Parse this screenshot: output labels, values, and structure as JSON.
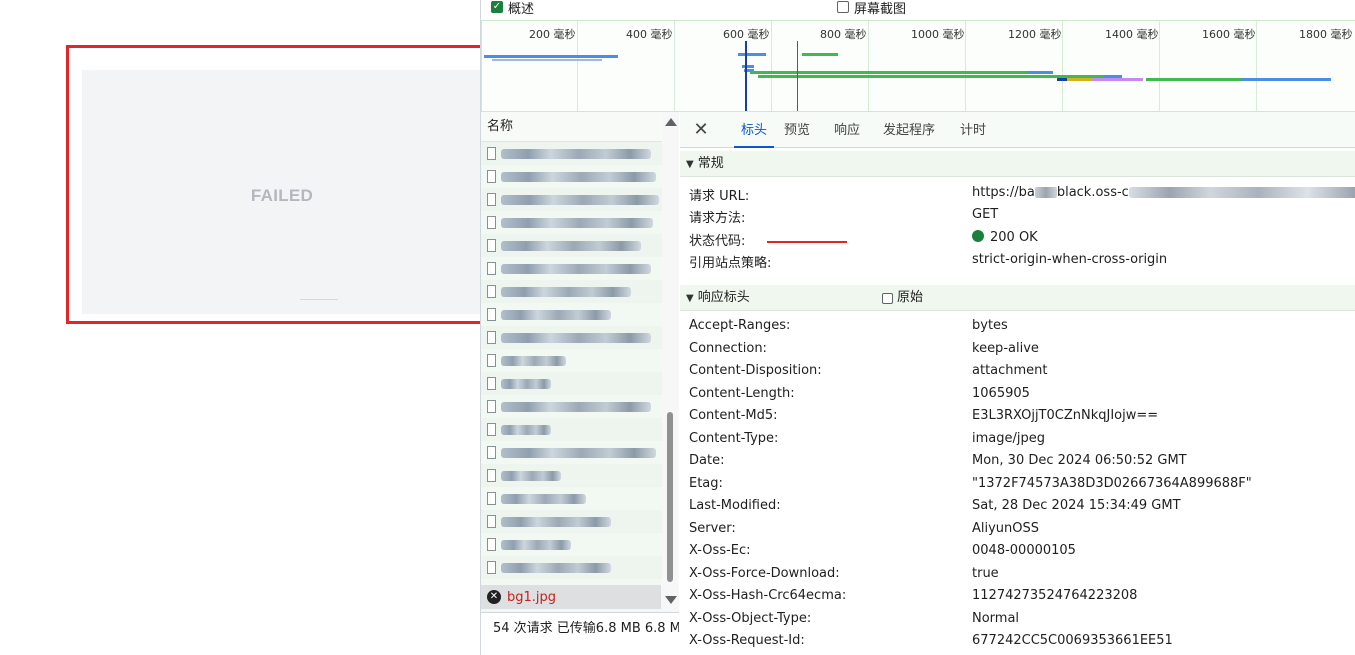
{
  "left_page": {
    "failed_text": "FAILED"
  },
  "options": {
    "overview_label": "概述",
    "overview_checked": true,
    "screenshot_label": "屏幕截图",
    "screenshot_checked": false
  },
  "timeline": {
    "tick_labels": [
      "200 毫秒",
      "400 毫秒",
      "600 毫秒",
      "800 毫秒",
      "1000 毫秒",
      "1200 毫秒",
      "1400 毫秒",
      "1600 毫秒",
      "1800 毫秒"
    ],
    "colors": {
      "green": "#3fb950",
      "blue": "#4a8ee8",
      "purple": "#c58af0",
      "yellow": "#d4b21a",
      "navy": "#1a3fa0",
      "red": "#d22"
    }
  },
  "request_list": {
    "header": "名称",
    "failed_item": {
      "name": "bg1.jpg"
    },
    "status": "54 次请求  已传输6.8 MB  6.8 M"
  },
  "details": {
    "tabs": [
      "标头",
      "预览",
      "响应",
      "发起程序",
      "计时"
    ],
    "active_tab": "标头",
    "general": {
      "title": "常规",
      "rows": [
        {
          "key": "请求 URL:",
          "value_prefix": "https://ba",
          "value_mid": "black.oss-c"
        },
        {
          "key": "请求方法:",
          "value": "GET"
        },
        {
          "key": "状态代码:",
          "value": "200 OK"
        },
        {
          "key": "引用站点策略:",
          "value": "strict-origin-when-cross-origin"
        }
      ]
    },
    "response_headers": {
      "title": "响应标头",
      "raw_label": "原始",
      "rows": [
        {
          "key": "Accept-Ranges:",
          "value": "bytes"
        },
        {
          "key": "Connection:",
          "value": "keep-alive"
        },
        {
          "key": "Content-Disposition:",
          "value": "attachment"
        },
        {
          "key": "Content-Length:",
          "value": "1065905"
        },
        {
          "key": "Content-Md5:",
          "value": "E3L3RXOjjT0CZnNkqJIojw=="
        },
        {
          "key": "Content-Type:",
          "value": "image/jpeg"
        },
        {
          "key": "Date:",
          "value": "Mon, 30 Dec 2024 06:50:52 GMT"
        },
        {
          "key": "Etag:",
          "value": "\"1372F74573A38D3D02667364A899688F\""
        },
        {
          "key": "Last-Modified:",
          "value": "Sat, 28 Dec 2024 15:34:49 GMT"
        },
        {
          "key": "Server:",
          "value": "AliyunOSS"
        },
        {
          "key": "X-Oss-Ec:",
          "value": "0048-00000105"
        },
        {
          "key": "X-Oss-Force-Download:",
          "value": "true"
        },
        {
          "key": "X-Oss-Hash-Crc64ecma:",
          "value": "11274273524764223208"
        },
        {
          "key": "X-Oss-Object-Type:",
          "value": "Normal"
        },
        {
          "key": "X-Oss-Request-Id:",
          "value": "677242CC5C0069353661EE51"
        }
      ]
    }
  }
}
